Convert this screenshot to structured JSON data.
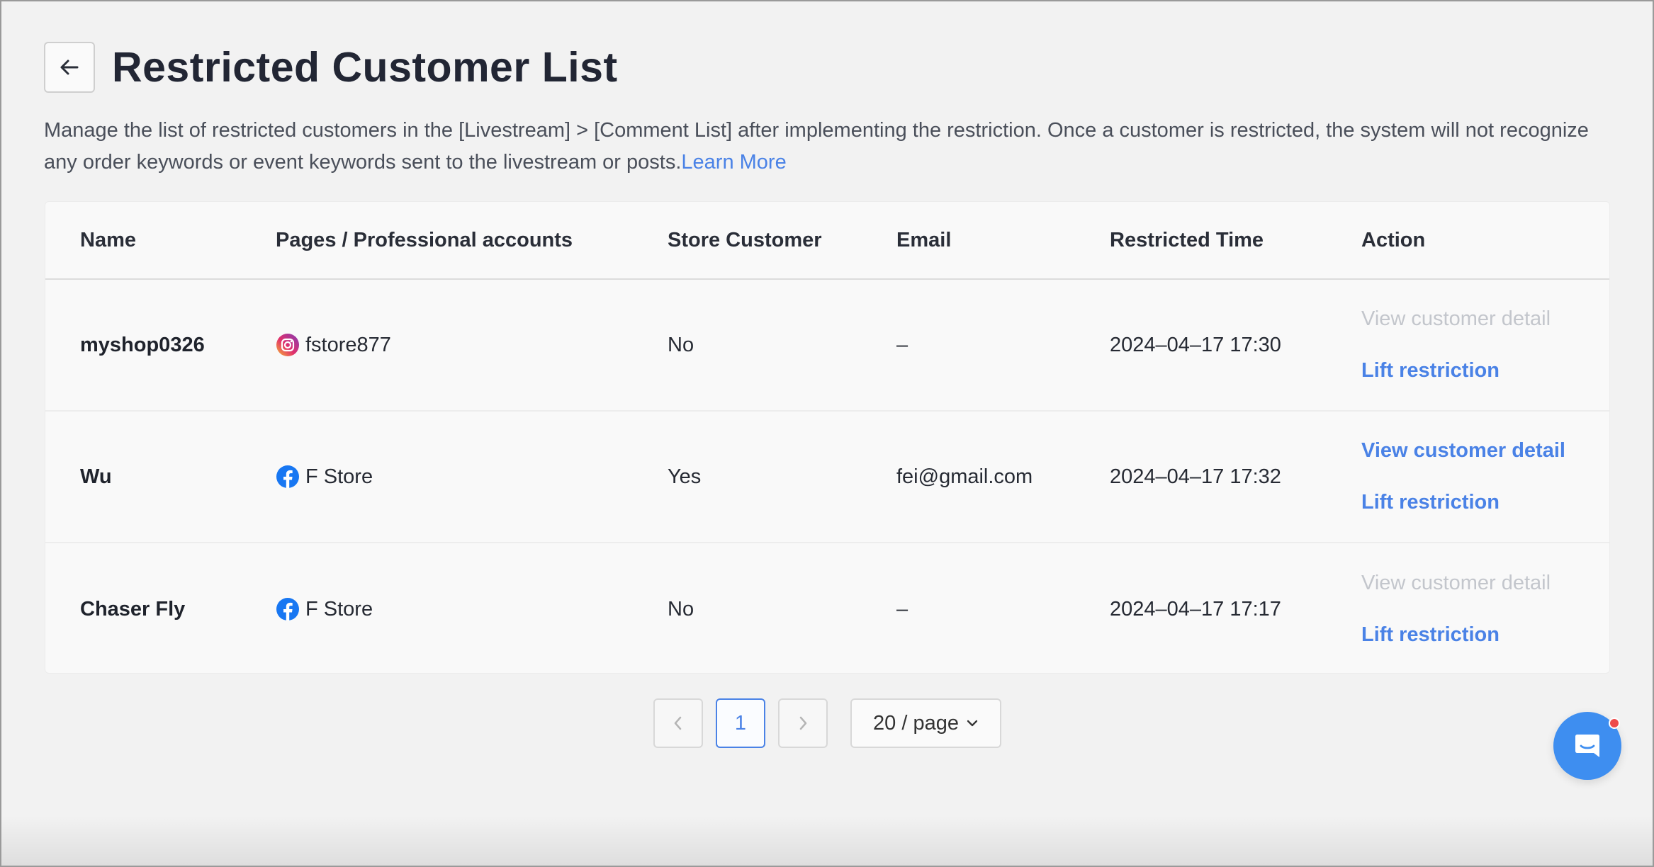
{
  "page": {
    "title": "Restricted Customer List",
    "description": "Manage the list of restricted customers in the [Livestream] > [Comment List] after implementing the restriction. Once a customer is restricted, the system will not recognize any order keywords or event keywords sent to the livestream or posts.",
    "learn_more": "Learn More"
  },
  "table": {
    "headers": {
      "name": "Name",
      "pages": "Pages / Professional accounts",
      "store_customer": "Store Customer",
      "email": "Email",
      "restricted_time": "Restricted Time",
      "action": "Action"
    },
    "rows": [
      {
        "name": "myshop0326",
        "platform_icon": "instagram-icon",
        "page": "fstore877",
        "store_customer": "No",
        "email": "–",
        "restricted_time": "2024–04–17 17:30",
        "view_detail": "View customer detail",
        "view_detail_enabled": false,
        "lift": "Lift restriction"
      },
      {
        "name": "Wu",
        "platform_icon": "facebook-icon",
        "page": "F Store",
        "store_customer": "Yes",
        "email": "fei@gmail.com",
        "restricted_time": "2024–04–17 17:32",
        "view_detail": "View customer detail",
        "view_detail_enabled": true,
        "lift": "Lift restriction"
      },
      {
        "name": "Chaser Fly",
        "platform_icon": "facebook-icon",
        "page": "F Store",
        "store_customer": "No",
        "email": "–",
        "restricted_time": "2024–04–17 17:17",
        "view_detail": "View customer detail",
        "view_detail_enabled": false,
        "lift": "Lift restriction"
      }
    ]
  },
  "pagination": {
    "current_page": "1",
    "page_size": "20 / page"
  },
  "colors": {
    "accent": "#4a82e6",
    "disabled_link": "#c3c6cc",
    "chat_button": "#3e8ef0",
    "notification_dot": "#ee4a4a"
  }
}
